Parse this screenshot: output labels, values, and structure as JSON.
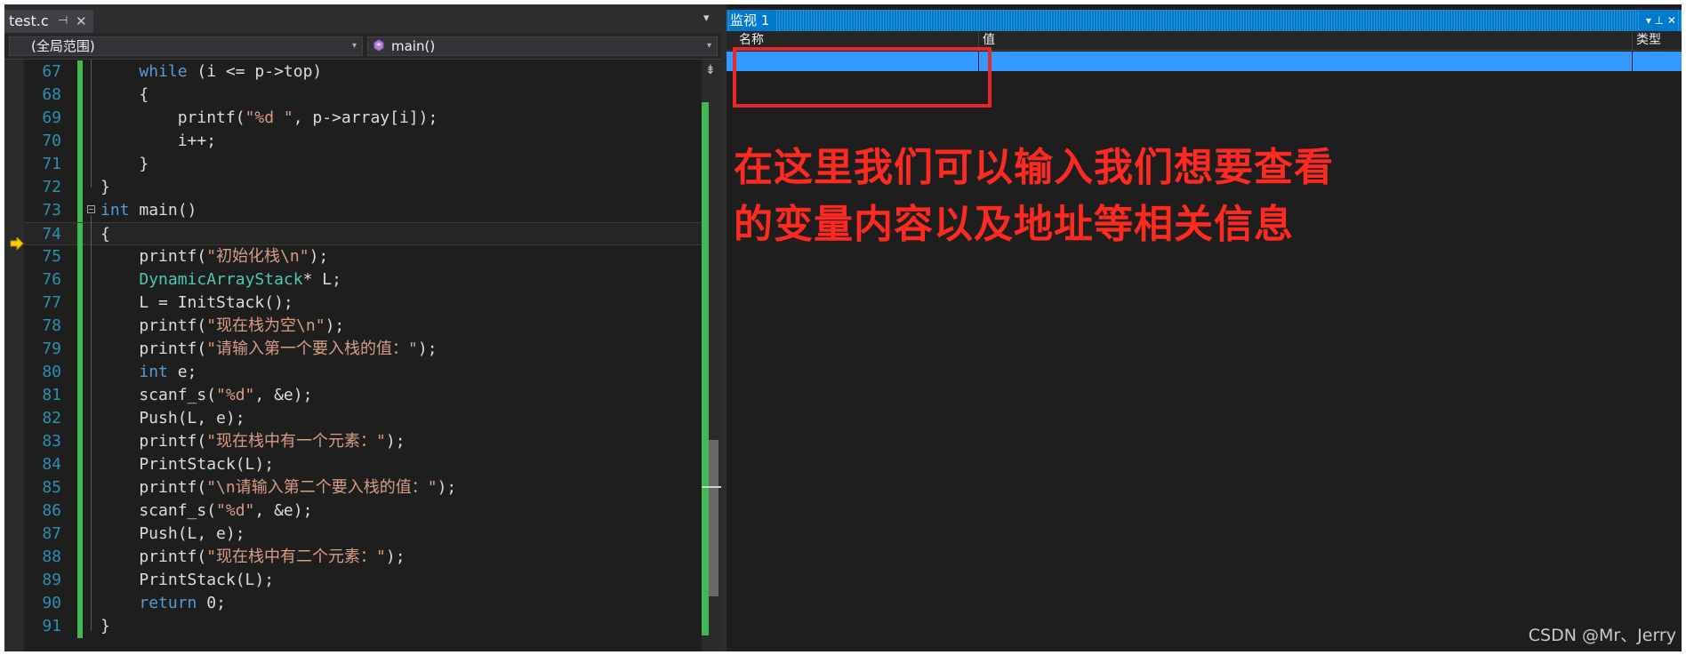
{
  "editor": {
    "tab": {
      "label": "test.c",
      "pin_glyph": "⊣",
      "close_glyph": "✕"
    },
    "tab_dropdown_glyph": "▾",
    "scope_combo": "(全局范围)",
    "func_combo": "main()",
    "combo_arrow": "▾",
    "split_glyph": "⇟",
    "lines": [
      {
        "n": "67",
        "code": [
          {
            "t": "    "
          },
          {
            "t": "while",
            "c": "kw"
          },
          {
            "t": " (i <= p->top)"
          }
        ]
      },
      {
        "n": "68",
        "code": [
          {
            "t": "    {"
          }
        ]
      },
      {
        "n": "69",
        "code": [
          {
            "t": "        printf("
          },
          {
            "t": "\"%d \"",
            "c": "str"
          },
          {
            "t": ", p->array[i]);"
          }
        ]
      },
      {
        "n": "70",
        "code": [
          {
            "t": "        i++;"
          }
        ]
      },
      {
        "n": "71",
        "code": [
          {
            "t": "    }"
          }
        ]
      },
      {
        "n": "72",
        "code": [
          {
            "t": "}"
          }
        ]
      },
      {
        "n": "73",
        "code": [
          {
            "t": "int",
            "c": "kw"
          },
          {
            "t": " main()"
          }
        ],
        "fold": true
      },
      {
        "n": "74",
        "code": [
          {
            "t": "{"
          }
        ],
        "current": true
      },
      {
        "n": "75",
        "code": [
          {
            "t": "    printf("
          },
          {
            "t": "\"初始化栈\\n\"",
            "c": "str"
          },
          {
            "t": ");"
          }
        ]
      },
      {
        "n": "76",
        "code": [
          {
            "t": "    "
          },
          {
            "t": "DynamicArrayStack",
            "c": "ty"
          },
          {
            "t": "* L;"
          }
        ]
      },
      {
        "n": "77",
        "code": [
          {
            "t": "    L = InitStack();"
          }
        ]
      },
      {
        "n": "78",
        "code": [
          {
            "t": "    printf("
          },
          {
            "t": "\"现在栈为空\\n\"",
            "c": "str"
          },
          {
            "t": ");"
          }
        ]
      },
      {
        "n": "79",
        "code": [
          {
            "t": "    printf("
          },
          {
            "t": "\"请输入第一个要入栈的值：\"",
            "c": "str"
          },
          {
            "t": ");"
          }
        ]
      },
      {
        "n": "80",
        "code": [
          {
            "t": "    "
          },
          {
            "t": "int",
            "c": "kw"
          },
          {
            "t": " e;"
          }
        ]
      },
      {
        "n": "81",
        "code": [
          {
            "t": "    scanf_s("
          },
          {
            "t": "\"%d\"",
            "c": "str"
          },
          {
            "t": ", &e);"
          }
        ]
      },
      {
        "n": "82",
        "code": [
          {
            "t": "    Push(L, e);"
          }
        ]
      },
      {
        "n": "83",
        "code": [
          {
            "t": "    printf("
          },
          {
            "t": "\"现在栈中有一个元素：\"",
            "c": "str"
          },
          {
            "t": ");"
          }
        ]
      },
      {
        "n": "84",
        "code": [
          {
            "t": "    PrintStack(L);"
          }
        ]
      },
      {
        "n": "85",
        "code": [
          {
            "t": "    printf("
          },
          {
            "t": "\"\\n请输入第二个要入栈的值：\"",
            "c": "str"
          },
          {
            "t": ");"
          }
        ]
      },
      {
        "n": "86",
        "code": [
          {
            "t": "    scanf_s("
          },
          {
            "t": "\"%d\"",
            "c": "str"
          },
          {
            "t": ", &e);"
          }
        ]
      },
      {
        "n": "87",
        "code": [
          {
            "t": "    Push(L, e);"
          }
        ]
      },
      {
        "n": "88",
        "code": [
          {
            "t": "    printf("
          },
          {
            "t": "\"现在栈中有二个元素：\"",
            "c": "str"
          },
          {
            "t": ");"
          }
        ]
      },
      {
        "n": "89",
        "code": [
          {
            "t": "    PrintStack(L);"
          }
        ]
      },
      {
        "n": "90",
        "code": [
          {
            "t": "    "
          },
          {
            "t": "return",
            "c": "kw"
          },
          {
            "t": " 0;"
          }
        ]
      },
      {
        "n": "91",
        "code": [
          {
            "t": "}"
          }
        ]
      }
    ]
  },
  "watch": {
    "title": "监视 1",
    "title_controls": "▾  ⊥  ✕",
    "columns": [
      "名称",
      "值",
      "类型"
    ],
    "annotation_line1": "在这里我们可以输入我们想要查看",
    "annotation_line2": "的变量内容以及地址等相关信息"
  },
  "watermark": "CSDN @Mr、Jerry",
  "colors": {
    "keyword": "#569cd6",
    "type": "#4ec9b0",
    "string": "#d69d85",
    "line_number": "#2b91af",
    "change_bar": "#3fb950",
    "selection": "#3399ff",
    "annotation": "#ff2a1f"
  },
  "icons": [
    "pin-icon",
    "close-icon",
    "function-icon",
    "current-statement-arrow-icon",
    "split-editor-icon",
    "fold-minus-icon"
  ]
}
